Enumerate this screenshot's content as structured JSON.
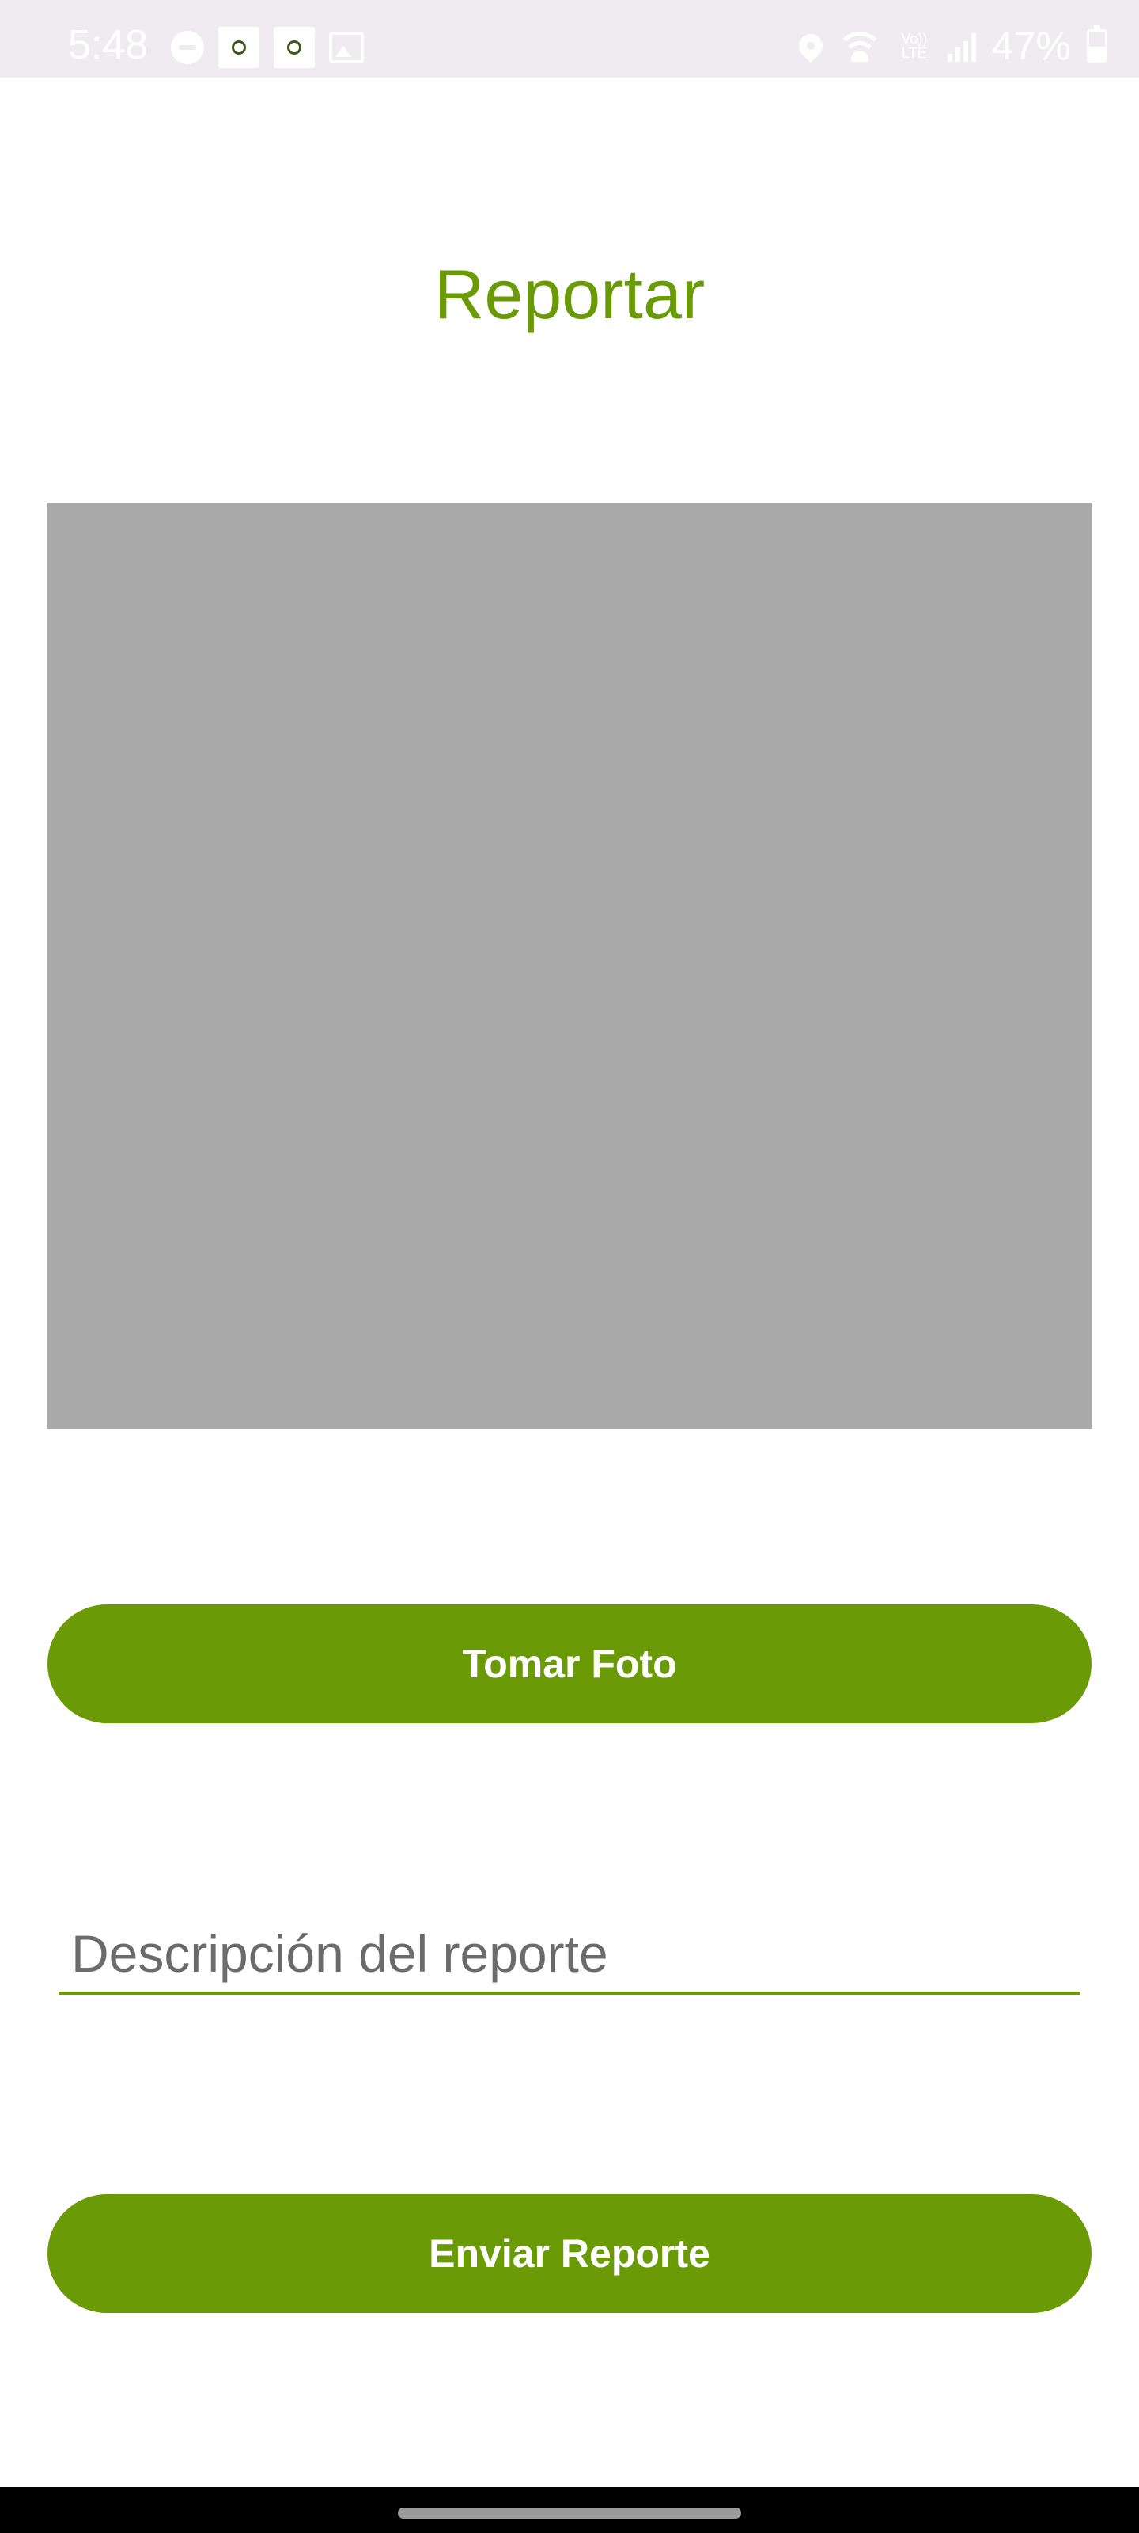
{
  "status_bar": {
    "time": "5:48",
    "left_icons": [
      "do-not-disturb-icon",
      "app-notification-icon",
      "app-notification-icon",
      "image-icon"
    ],
    "right_icons": [
      "location-icon",
      "wifi-icon",
      "volte-icon",
      "signal-icon"
    ],
    "volte_label_top": "Vo))",
    "volte_label_bottom": "LTE",
    "battery_percent": "47%",
    "battery_level": 0.47
  },
  "screen": {
    "title": "Reportar",
    "photo_preview_color": "#a9a9a9",
    "take_photo_label": "Tomar Foto",
    "description_placeholder": "Descripción del reporte",
    "description_value": "",
    "send_report_label": "Enviar Reporte",
    "accent_color": "#6a9a05"
  },
  "navigation": {
    "home_handle": "gesture-handle"
  }
}
